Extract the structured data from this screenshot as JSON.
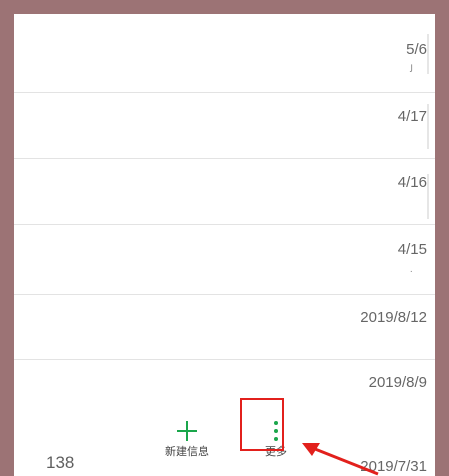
{
  "conversations": [
    {
      "date": "5/6",
      "mark": "ﻟ"
    },
    {
      "date": "4/17",
      "mark": ""
    },
    {
      "date": "4/16",
      "mark": ""
    },
    {
      "date": "4/15",
      "mark": "·"
    },
    {
      "date": "2019/8/12",
      "mark": ""
    },
    {
      "date": "2019/8/9",
      "mark": ""
    }
  ],
  "last_date": "2019/7/31",
  "bottom_bar": {
    "count": "138",
    "new_message_label": "新建信息",
    "more_label": "更多"
  },
  "colors": {
    "accent": "#1aa64b",
    "highlight": "#e2201c"
  }
}
